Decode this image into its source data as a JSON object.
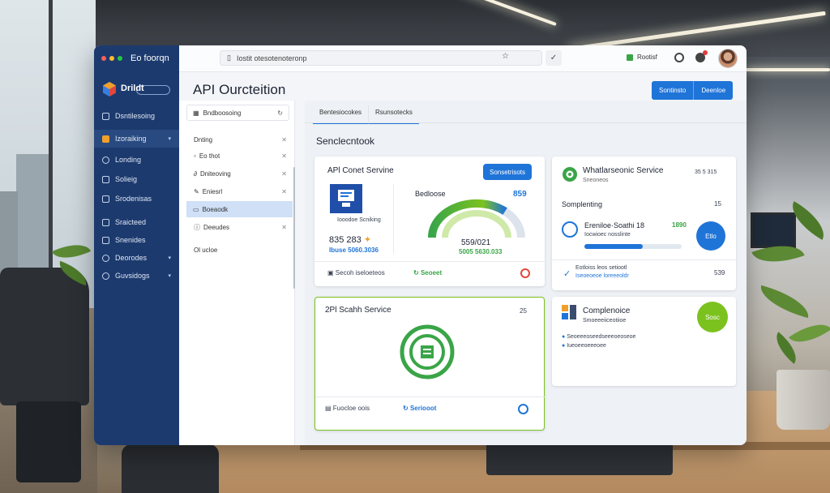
{
  "window": {
    "title": "Eo foorqn"
  },
  "sidebar": {
    "brand": "Drildt",
    "items": [
      {
        "label": "Dsntilesoing",
        "icon": "box-icon"
      },
      {
        "label": "Izoraiking",
        "icon": "folder-icon"
      },
      {
        "label": "Londing",
        "icon": "cloud-icon"
      },
      {
        "label": "Solieig",
        "icon": "doc-icon"
      },
      {
        "label": "Srodenisas",
        "icon": "grid-icon"
      },
      {
        "label": "Sraicteed",
        "icon": "chart-icon"
      },
      {
        "label": "Snenides",
        "icon": "list-icon"
      },
      {
        "label": "Deorodes",
        "icon": "globe-icon"
      },
      {
        "label": "Guvsidogs",
        "icon": "settings-icon"
      }
    ]
  },
  "topbar": {
    "url": "Iostit otesotenoteronp",
    "badge": "Rootisf"
  },
  "header": {
    "title": "API Ourcteition",
    "btn_primary": "Sontinsto",
    "btn_secondary": "Deenloe"
  },
  "panel": {
    "search": "Bndboosoing",
    "items": [
      "Dnting",
      "Eo thot",
      "Dniteoving",
      "Eniesrl",
      "Boeaodk",
      "Deeudes",
      "Ol ucloe"
    ],
    "selected_index": 4
  },
  "tabs": [
    "Bentesiocokes",
    "Rsunsotecks"
  ],
  "section_title": "Senclecntook",
  "cards": {
    "api": {
      "title": "APl Conet Servine",
      "button": "Sonsetrisots",
      "metric_label": "Bedloose",
      "metric_value": "859",
      "sub_label": "Iooodoe Scniking",
      "stat1": "835 283",
      "stat2": "Ibuse 5060.3036",
      "gauge_value": "559/021",
      "gauge_sub": "5005 5630.033",
      "footer_left": "Secoh iseloeteos",
      "footer_mid": "Seoeet",
      "gauge_fill": 0.72
    },
    "whatlist": {
      "title": "Whatlarseonic Service",
      "count": "35 5 315",
      "subtitle": "Sneoneos",
      "section": "Somplenting",
      "section_value": "15",
      "row_title": "Ereniloe·Soathi 18",
      "row_value": "1890",
      "row_sub": "Iocwioec nosslinte",
      "button": "Etlo",
      "progress": 0.6,
      "footer_line1": "Eotloiss leos setiootl",
      "footer_line2": "Iseoeoeoe loreeeoldr",
      "footer_value": "539"
    },
    "search": {
      "title": "2Pl Scahh Service",
      "value": "25",
      "footer_left": "Fuocloe oois",
      "footer_mid": "Seriooot"
    },
    "compliance": {
      "title": "Complenoice",
      "subtitle": "Smoeeeiiceotiioe",
      "line1": "Seoeeeoseedseeeoeoseoe",
      "line2": "Iueoeeoeeeoee",
      "badge": "Sosc"
    }
  },
  "colors": {
    "sidebar": "#1c3a6e",
    "accent": "#1f74d8",
    "green": "#3aa547",
    "lime": "#7cc21f"
  }
}
